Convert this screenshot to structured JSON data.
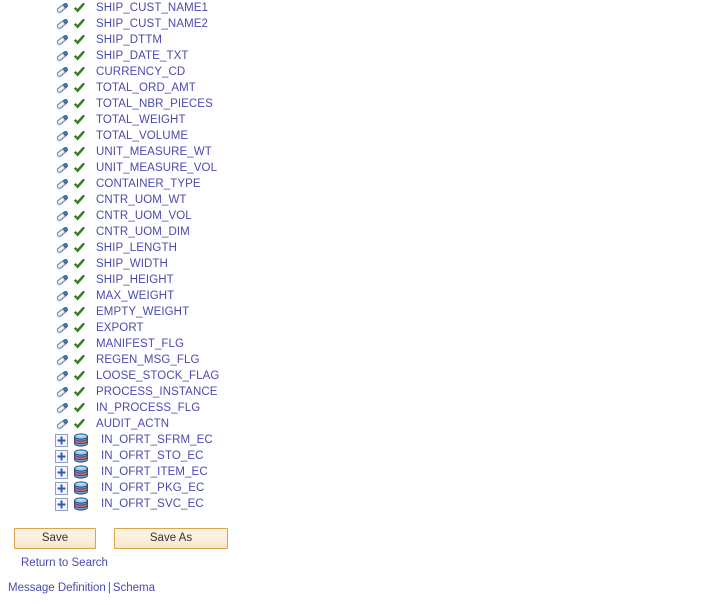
{
  "tree": {
    "leaf_icon_name": "field-pill-icon",
    "check_icon_name": "green-check-icon",
    "expand_icon_name": "plus-expand-icon",
    "record_icon_name": "database-record-icon",
    "nodes": [
      {
        "label": "SHIP_CUST_NAME1",
        "type": "field"
      },
      {
        "label": "SHIP_CUST_NAME2",
        "type": "field"
      },
      {
        "label": "SHIP_DTTM",
        "type": "field"
      },
      {
        "label": "SHIP_DATE_TXT",
        "type": "field"
      },
      {
        "label": "CURRENCY_CD",
        "type": "field"
      },
      {
        "label": "TOTAL_ORD_AMT",
        "type": "field"
      },
      {
        "label": "TOTAL_NBR_PIECES",
        "type": "field"
      },
      {
        "label": "TOTAL_WEIGHT",
        "type": "field"
      },
      {
        "label": "TOTAL_VOLUME",
        "type": "field"
      },
      {
        "label": "UNIT_MEASURE_WT",
        "type": "field"
      },
      {
        "label": "UNIT_MEASURE_VOL",
        "type": "field"
      },
      {
        "label": "CONTAINER_TYPE",
        "type": "field"
      },
      {
        "label": "CNTR_UOM_WT",
        "type": "field"
      },
      {
        "label": "CNTR_UOM_VOL",
        "type": "field"
      },
      {
        "label": "CNTR_UOM_DIM",
        "type": "field"
      },
      {
        "label": "SHIP_LENGTH",
        "type": "field"
      },
      {
        "label": "SHIP_WIDTH",
        "type": "field"
      },
      {
        "label": "SHIP_HEIGHT",
        "type": "field"
      },
      {
        "label": "MAX_WEIGHT",
        "type": "field"
      },
      {
        "label": "EMPTY_WEIGHT",
        "type": "field"
      },
      {
        "label": "EXPORT",
        "type": "field"
      },
      {
        "label": "MANIFEST_FLG",
        "type": "field"
      },
      {
        "label": "REGEN_MSG_FLG",
        "type": "field"
      },
      {
        "label": "LOOSE_STOCK_FLAG",
        "type": "field"
      },
      {
        "label": "PROCESS_INSTANCE",
        "type": "field"
      },
      {
        "label": "IN_PROCESS_FLG",
        "type": "field"
      },
      {
        "label": "AUDIT_ACTN",
        "type": "field"
      },
      {
        "label": "IN_OFRT_SFRM_EC",
        "type": "record"
      },
      {
        "label": "IN_OFRT_STO_EC",
        "type": "record"
      },
      {
        "label": "IN_OFRT_ITEM_EC",
        "type": "record"
      },
      {
        "label": "IN_OFRT_PKG_EC",
        "type": "record"
      },
      {
        "label": "IN_OFRT_SVC_EC",
        "type": "record"
      }
    ]
  },
  "buttons": {
    "save_label": "Save",
    "save_as_label": "Save As"
  },
  "links": {
    "return_to_search": "Return to Search",
    "message_definition": "Message Definition",
    "separator": "|",
    "schema": "Schema"
  },
  "colors": {
    "link": "#4a4ab0",
    "button_border": "#d9a549",
    "button_fill": "#fbeedb",
    "check": "#2e8b2e",
    "record_band": "#e06050",
    "record_body": "#6b9bd8"
  }
}
